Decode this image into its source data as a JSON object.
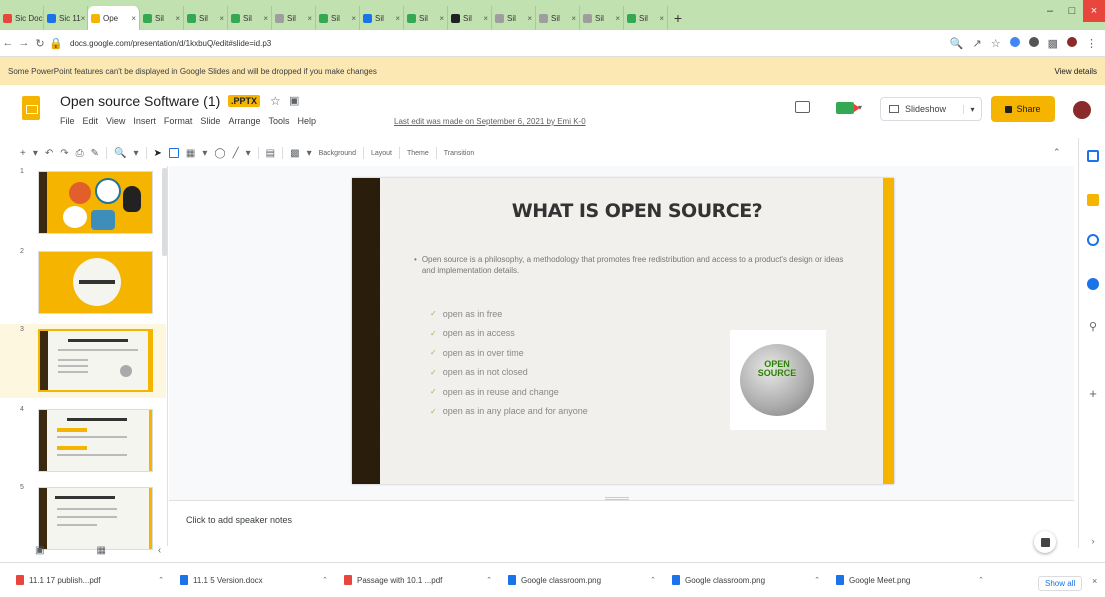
{
  "browser": {
    "tabs": [
      {
        "label": "Sic Doc",
        "favicon_color": "#e8453c"
      },
      {
        "label": "Sic 11",
        "favicon_color": "#1a73e8"
      },
      {
        "label": "Ope",
        "favicon_color": "#f4b400",
        "active": true
      },
      {
        "label": "Sil",
        "favicon_color": "#34a853"
      },
      {
        "label": "Sil",
        "favicon_color": "#34a853"
      },
      {
        "label": "Sil",
        "favicon_color": "#34a853"
      },
      {
        "label": "Sil",
        "favicon_color": "#9e9e9e"
      },
      {
        "label": "Sil",
        "favicon_color": "#34a853"
      },
      {
        "label": "Sil",
        "favicon_color": "#1a73e8"
      },
      {
        "label": "Sil",
        "favicon_color": "#34a853"
      },
      {
        "label": "Sil",
        "favicon_color": "#202124"
      },
      {
        "label": "Sil",
        "favicon_color": "#9e9e9e"
      },
      {
        "label": "Sil",
        "favicon_color": "#9e9e9e"
      },
      {
        "label": "Sil",
        "favicon_color": "#9e9e9e"
      },
      {
        "label": "Sil",
        "favicon_color": "#34a853"
      }
    ],
    "new_tab": "+",
    "url": "docs.google.com/presentation/d/1kxbuQ/edit#slide=id.p3",
    "warning_text": "Some PowerPoint features can't be displayed in Google Slides and will be dropped if you make changes",
    "warning_link": "View details"
  },
  "doc": {
    "title": "Open source Software (1)",
    "badge": ".PPTX",
    "menu": [
      "File",
      "Edit",
      "View",
      "Insert",
      "Format",
      "Slide",
      "Arrange",
      "Tools",
      "Help"
    ],
    "last_edit": "Last edit was made on September 6, 2021 by Emi K-0",
    "slideshow_label": "Slideshow",
    "share_label": "Share"
  },
  "toolbar": {
    "items": [
      "Background",
      "Layout",
      "Theme",
      "Transition"
    ]
  },
  "slides": [
    {
      "num": "1"
    },
    {
      "num": "2"
    },
    {
      "num": "3"
    },
    {
      "num": "4"
    },
    {
      "num": "5"
    }
  ],
  "slide": {
    "title": "WHAT IS OPEN SOURCE?",
    "body": "Open source is a philosophy,   a methodology that promotes free redistribution and access to a product's design or ideas and implementation details.",
    "checklist": [
      "open as in free",
      "open as in access",
      "open as in over time",
      "open as in not closed",
      "open as in reuse and change",
      "open as in any place and for anyone"
    ],
    "image_label_1": "OPEN",
    "image_label_2": "SOURCE"
  },
  "notes": {
    "placeholder": "Click to add speaker notes"
  },
  "downloads": [
    {
      "name": "11.1 17 publish...pdf",
      "color": "#e8453c"
    },
    {
      "name": "11.1 5 Version.docx",
      "color": "#1a73e8"
    },
    {
      "name": "Passage with 10.1 ...pdf",
      "color": "#e8453c"
    },
    {
      "name": "Google classroom.png",
      "color": "#1a73e8"
    },
    {
      "name": "Google classroom.png",
      "color": "#1a73e8"
    },
    {
      "name": "Google Meet.png",
      "color": "#1a73e8"
    }
  ],
  "show_all": "Show all",
  "colors": {
    "accent": "#f4b400",
    "brand_dark": "#2b1d0b",
    "link": "#1a73e8"
  }
}
